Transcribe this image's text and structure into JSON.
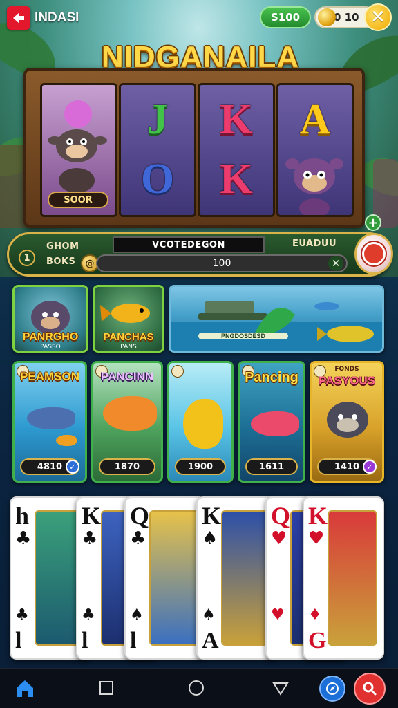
{
  "header": {
    "brand_name": "INDASI",
    "coins": "S100",
    "gems": "0 10",
    "close_symbol": "✕"
  },
  "game": {
    "title": "NIDGANAILA",
    "reels": [
      {
        "top": "",
        "bottom": "",
        "badge": "SOOR"
      },
      {
        "top": "J",
        "bottom": "O"
      },
      {
        "top": "K",
        "bottom": "K"
      },
      {
        "top": "A",
        "bottom": ""
      }
    ],
    "add_symbol": "+"
  },
  "controls": {
    "level_number": "1",
    "label_line1": "GHOM",
    "label_line2": "BOKS",
    "display_text": "VCOTEDEGON",
    "bet_value": "100",
    "right_label": "EUADUU",
    "coin_symbol": "@",
    "x_symbol": "✕"
  },
  "featured": [
    {
      "title": "PANRGHO",
      "subtitle": "PASSO"
    },
    {
      "title": "PANCHAS",
      "subtitle": "PANS"
    },
    {
      "title": "",
      "banner": "PNGDOSDESD"
    }
  ],
  "games": [
    {
      "title": "PEAMSON",
      "score": "4810"
    },
    {
      "title": "PANCINN",
      "score": "1870"
    },
    {
      "title": "",
      "score": "1900"
    },
    {
      "title": "Pancing",
      "score": "1611"
    },
    {
      "title": "PASYOUS",
      "subtitle": "FONDS",
      "score": "1410"
    }
  ],
  "cards": [
    {
      "rank": "h",
      "suit": "♣",
      "rank_b": "l",
      "suit_b": "♣",
      "color": "black"
    },
    {
      "rank": "K",
      "suit": "♣",
      "rank_b": "l",
      "suit_b": "♣",
      "color": "black"
    },
    {
      "rank": "Q",
      "suit": "♣",
      "rank_b": "l",
      "suit_b": "♠",
      "color": "black"
    },
    {
      "rank": "K",
      "suit": "♠",
      "rank_b": "A",
      "suit_b": "♠",
      "color": "black"
    },
    {
      "rank": "Q",
      "suit": "♥",
      "rank_b": "",
      "suit_b": "♥",
      "color": "red"
    },
    {
      "rank": "K",
      "suit": "♥",
      "rank_b": "G",
      "suit_b": "♦",
      "color": "red"
    }
  ],
  "nav": {
    "items": [
      "home-icon",
      "square-icon",
      "circle-icon",
      "triangle-back-icon",
      "compass-icon",
      "search-icon"
    ]
  },
  "colors": {
    "accent_gold": "#d9b24a",
    "brand_red": "#e3182d",
    "green": "#3fb04a"
  }
}
